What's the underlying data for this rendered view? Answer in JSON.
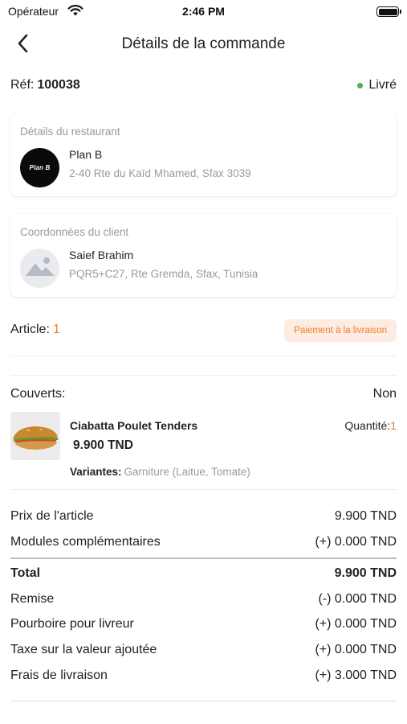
{
  "status_bar": {
    "carrier": "Opérateur",
    "time": "2:46 PM"
  },
  "nav": {
    "title": "Détails de la commande"
  },
  "order": {
    "ref_label": "Réf:",
    "ref_value": "100038",
    "status": "Livré",
    "status_color": "#4caf50"
  },
  "restaurant": {
    "section_title": "Détails du restaurant",
    "name": "Plan B",
    "address": "2-40 Rte du Kaïd Mhamed, Sfax 3039",
    "logo_text": "Plan B"
  },
  "client": {
    "section_title": "Coordonnées du client",
    "name": "Saief Brahim",
    "address": "PQR5+C27, Rte Gremda, Sfax, Tunisia"
  },
  "article": {
    "label": "Article:",
    "count": "1",
    "payment_badge": "Paiement à la livraison"
  },
  "couverts": {
    "label": "Couverts:",
    "value": "Non"
  },
  "item": {
    "name": "Ciabatta Poulet Tenders",
    "price": "9.900 TND",
    "quantity_label": "Quantité:",
    "quantity_value": "1",
    "variants_label": "Variantes:",
    "variants_value": "Garniture (Laitue, Tomate)"
  },
  "summary": {
    "item_price_label": "Prix de l'article",
    "item_price_value": "9.900 TND",
    "addons_label": "Modules complémentaires",
    "addons_value": "(+)  0.000 TND",
    "total_label": "Total",
    "total_value": "9.900 TND",
    "discount_label": "Remise",
    "discount_value": "(-)  0.000 TND",
    "tip_label": "Pourboire pour livreur",
    "tip_value": "(+)  0.000 TND",
    "vat_label": "Taxe sur la valeur ajoutée",
    "vat_value": "(+)  0.000 TND",
    "delivery_label": "Frais de livraison",
    "delivery_value": "(+)  3.000 TND"
  },
  "colors": {
    "accent": "#f07b2b",
    "badge_bg": "#fdece1",
    "muted": "#9a9a9a"
  },
  "icons": {
    "back": "chevron-left-icon",
    "wifi": "wifi-icon",
    "battery": "battery-icon",
    "client_avatar": "image-placeholder-icon"
  }
}
